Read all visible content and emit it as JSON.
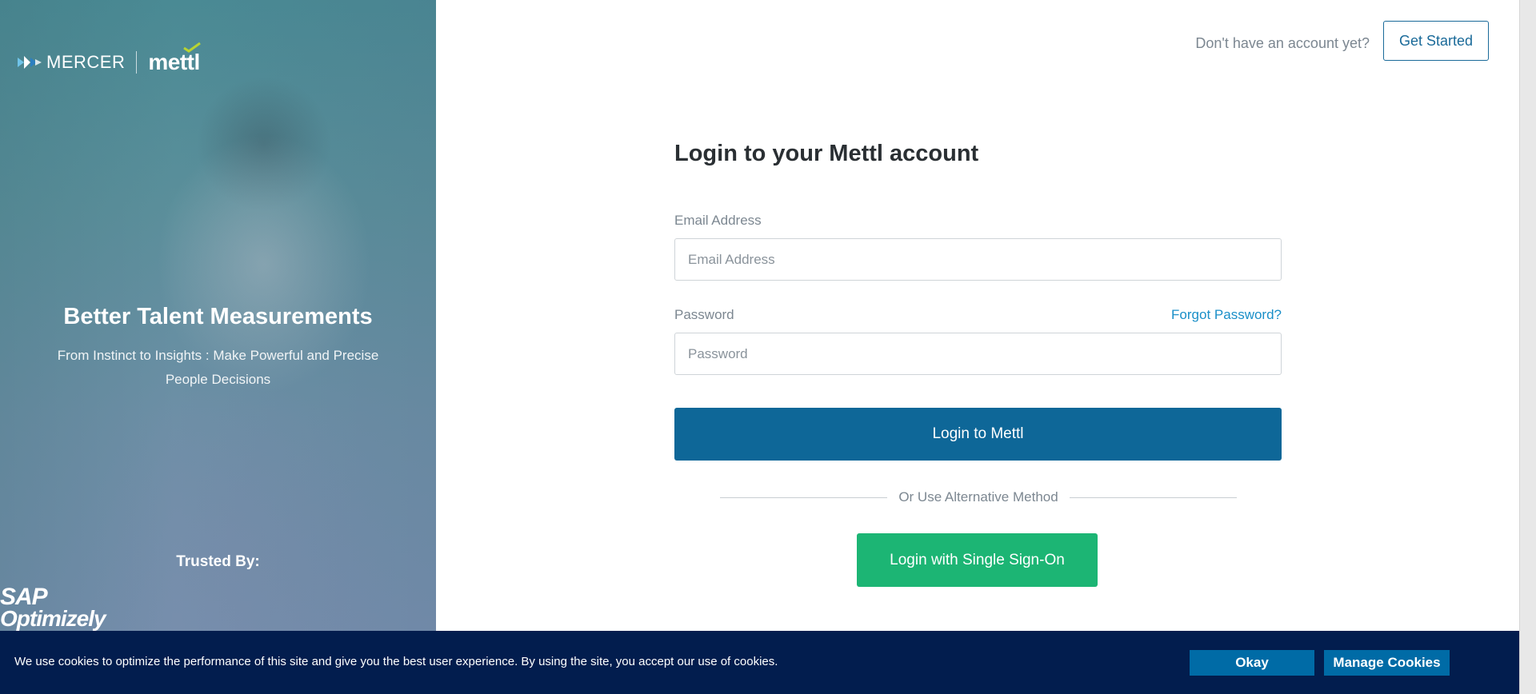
{
  "hero": {
    "brand_mercer": "MERCER",
    "brand_mettl": "mettl",
    "title": "Better Talent Measurements",
    "subtitle": "From Instinct to Insights : Make Powerful and Precise People Decisions",
    "trusted_label": "Trusted By:",
    "client_logos": [
      "SAP",
      "Optimizely"
    ]
  },
  "header": {
    "signup_prompt": "Don't have an account yet?",
    "get_started_label": "Get Started"
  },
  "form": {
    "title": "Login to your Mettl account",
    "email_label": "Email Address",
    "email_placeholder": "Email Address",
    "email_value": "",
    "password_label": "Password",
    "password_placeholder": "Password",
    "password_value": "",
    "forgot_label": "Forgot Password?",
    "login_button": "Login to Mettl",
    "divider_text": "Or Use Alternative Method",
    "sso_button": "Login with Single Sign-On"
  },
  "cookie": {
    "message": "We use cookies to optimize the performance of this site and give you the best user experience. By using the site, you accept our use of cookies.",
    "okay_label": "Okay",
    "manage_label": "Manage Cookies"
  },
  "colors": {
    "primary": "#0e6798",
    "sso_green": "#1cb574",
    "link": "#1a8fc8",
    "cookie_bg": "#021d4e"
  }
}
